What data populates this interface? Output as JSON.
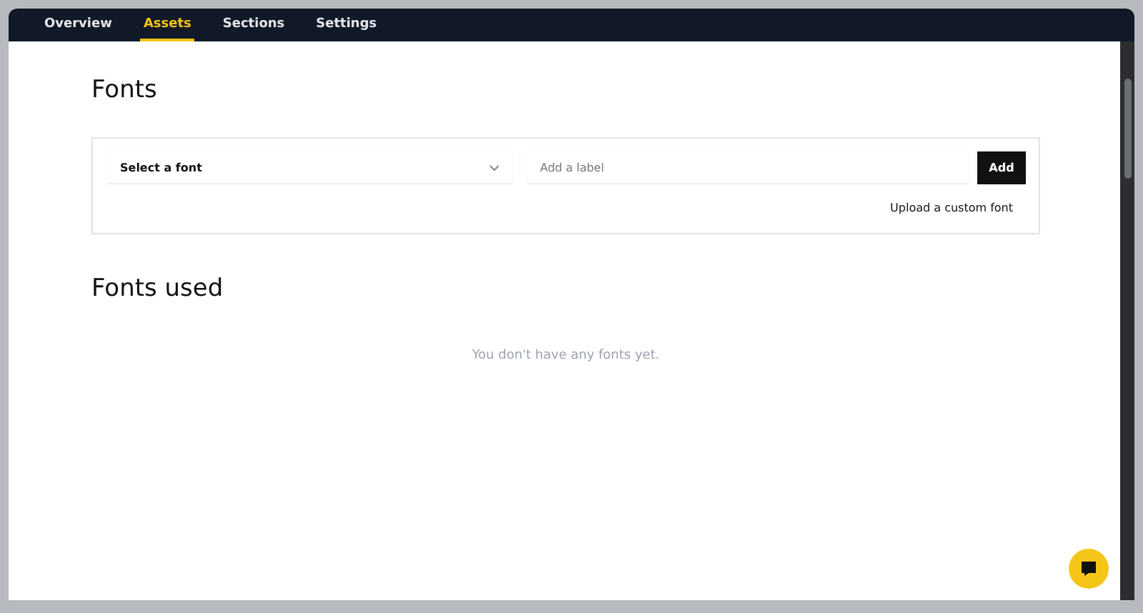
{
  "tabs": [
    {
      "label": "Overview",
      "selected": false
    },
    {
      "label": "Assets",
      "selected": true
    },
    {
      "label": "Sections",
      "selected": false
    },
    {
      "label": "Settings",
      "selected": false
    }
  ],
  "fonts": {
    "title": "Fonts",
    "select": {
      "value": "Select a font"
    },
    "label_field": {
      "placeholder": "Add a label"
    },
    "add_button": "Add",
    "upload_link": "Upload a custom font"
  },
  "fonts_used": {
    "title": "Fonts used",
    "empty_message": "You don't have any fonts yet."
  }
}
